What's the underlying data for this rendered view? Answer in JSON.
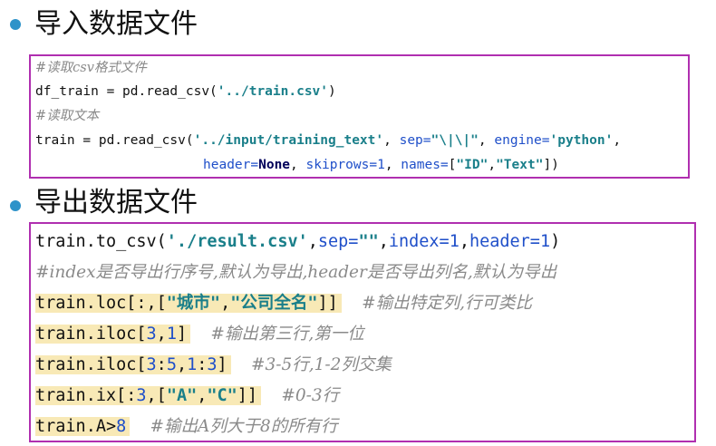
{
  "section1": {
    "title": "导入数据文件",
    "lines": [
      {
        "comment": "#读取csv格式文件"
      },
      {
        "pre": "df_train = pd.read_csv(",
        "s1": "'../train.csv'",
        "post": ")"
      },
      {
        "comment": "#读取文本"
      },
      {
        "pre": "train = pd.read_csv(",
        "s1": "'../input/training_text'",
        "p1": ", ",
        "k1": "sep=",
        "s2": "\"\\|\\|\"",
        "p2": ", ",
        "k2": "engine=",
        "s3": "'python'",
        "p3": ","
      },
      {
        "k1": "header=",
        "kw": "None",
        "p1": ", ",
        "k2": "skiprows=",
        "n1": "1",
        "p2": ", ",
        "k3": "names=",
        "p3": "[",
        "s1": "\"ID\"",
        "p4": ",",
        "s2": "\"Text\"",
        "p5": "])"
      }
    ]
  },
  "section2": {
    "title": "导出数据文件",
    "lines": [
      {
        "pre": "train.to_csv(",
        "s1": "'./result.csv'",
        "p1": ",",
        "k1": "sep=",
        "s2": "\"\"",
        "p2": ",",
        "k2": "index=",
        "n1": "1",
        "p3": ",",
        "k3": "header=",
        "n2": "1",
        "post": ")"
      },
      {
        "comment": "#index是否导出行序号,默认为导出,header是否导出列名,默认为导出"
      },
      {
        "code": "train.loc[:,[",
        "s1": "\"城市\"",
        "p1": ",",
        "s2": "\"公司全名\"",
        "p2": "]]",
        "comment": "#输出特定列,行可类比"
      },
      {
        "code": "train.iloc[",
        "n1": "3",
        "p1": ",",
        "n2": "1",
        "p2": "]",
        "comment": "#输出第三行,第一位"
      },
      {
        "code": "train.iloc[",
        "n1": "3",
        "p1": ":",
        "n2": "5",
        "p2": ",",
        "n3": "1",
        "p3": ":",
        "n4": "3",
        "p4": "]",
        "comment": "#3-5行,1-2列交集"
      },
      {
        "code": "train.ix[:",
        "n1": "3",
        "p1": ",[",
        "s1": "\"A\"",
        "p2": ",",
        "s2": "\"C\"",
        "p3": "]]",
        "comment": "#0-3行"
      },
      {
        "code": "train.A>",
        "n1": "8",
        "comment": "#输出A列大于8的所有行"
      }
    ]
  },
  "colors": {
    "bullet": "#2e93c9",
    "box_border": "#b02fb0",
    "highlight": "#f8e9b6",
    "string": "#1a7f8a",
    "number": "#1f4fc9",
    "comment": "#8a8a8a"
  }
}
